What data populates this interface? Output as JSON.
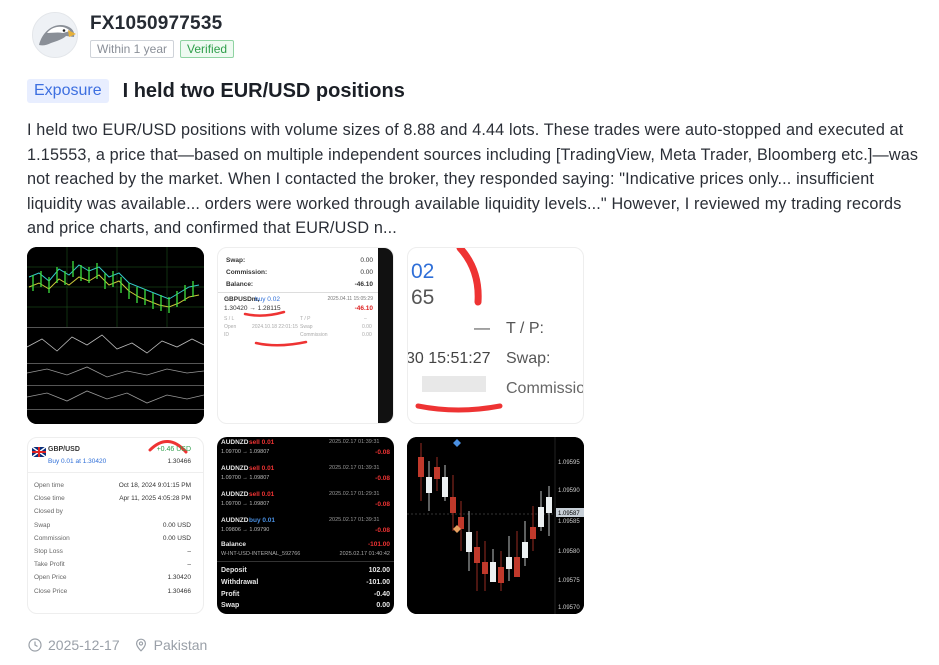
{
  "user": {
    "name": "FX1050977535",
    "badge_age": "Within 1 year",
    "badge_verified": "Verified"
  },
  "post": {
    "tag": "Exposure",
    "title": "I held two EUR/USD positions",
    "body": "I held two EUR/USD positions with volume sizes of 8.88 and 4.44 lots. These trades were auto-stopped and executed at 1.15553, a price that—based on multiple independent sources including [TradingView, Meta Trader, Bloomberg etc.]—was not reached by the market. When I contacted the broker, they responded saying: \"Indicative prices only... insufficient liquidity was available... orders were worked through available liquidity levels...\" However, I reviewed my trading records and price charts, and confirmed that EUR/USD n..."
  },
  "images": {
    "img2": {
      "swap": "Swap:",
      "swap_val": "0.00",
      "commission": "Commission:",
      "commission_val": "0.00",
      "balance": "Balance:",
      "balance_val": "-46.10",
      "symbol": "GBPUSDm,",
      "side": "buy 0.02",
      "date": "2025.04.11 15:05:29",
      "prices": "1.30420 → 1.28115",
      "pl": "-46.10"
    },
    "img3": {
      "n1": "02",
      "n2": "65",
      "dash": "—",
      "tp": "T / P:",
      "time": "30 15:51:27",
      "swap": "Swap:",
      "commission": "Commissio"
    },
    "img4": {
      "symbol": "GBP/USD",
      "pl": "+0.46 USD",
      "side": "Buy 0.01 at 1.30420",
      "price": "1.30466",
      "rows": [
        {
          "k": "Open time",
          "v": "Oct 18, 2024 9:01:15 PM"
        },
        {
          "k": "Close time",
          "v": "Apr 11, 2025 4:05:28 PM"
        },
        {
          "k": "Closed by",
          "v": ""
        },
        {
          "k": "Swap",
          "v": "0.00 USD"
        },
        {
          "k": "Commission",
          "v": "0.00 USD"
        },
        {
          "k": "Stop Loss",
          "v": "–"
        },
        {
          "k": "Take Profit",
          "v": "–"
        },
        {
          "k": "Open Price",
          "v": "1.30420"
        },
        {
          "k": "Close Price",
          "v": "1.30466"
        }
      ]
    },
    "img5": {
      "rows": [
        {
          "sym": "AUDNZD",
          "side": "sell 0.01",
          "p": "1.09700 → 1.09807",
          "d": "2025.02.17 01:39:31",
          "pl": "-0.08"
        },
        {
          "sym": "AUDNZD",
          "side": "sell 0.01",
          "p": "1.09700 → 1.09807",
          "d": "2025.02.17 01:39:31",
          "pl": "-0.08"
        },
        {
          "sym": "AUDNZD",
          "side": "sell 0.01",
          "p": "1.09700 → 1.09807",
          "d": "2025.02.17 01:29:31",
          "pl": "-0.08"
        },
        {
          "sym": "AUDNZD",
          "side": "buy 0.01",
          "p": "1.09806 → 1.09790",
          "d": "2025.02.17 01:39:31",
          "pl": "-0.08"
        }
      ],
      "balance_label": "Balance",
      "balance_val": "-101.00",
      "account": "W-INT-USD-INTERNAL_592766",
      "account_date": "2025.02.17 01:40:42",
      "deposit": "Deposit",
      "deposit_val": "102.00",
      "withdrawal": "Withdrawal",
      "withdrawal_val": "-101.00",
      "profit": "Profit",
      "profit_val": "-0.40",
      "swap": "Swap",
      "swap_val": "0.00"
    },
    "img6": {
      "ticks": [
        "1.09595",
        "1.09590",
        "1.09585",
        "1.09580",
        "1.09575",
        "1.09570"
      ],
      "current": "1.09587"
    }
  },
  "footer": {
    "date": "2025-12-17",
    "location": "Pakistan"
  }
}
